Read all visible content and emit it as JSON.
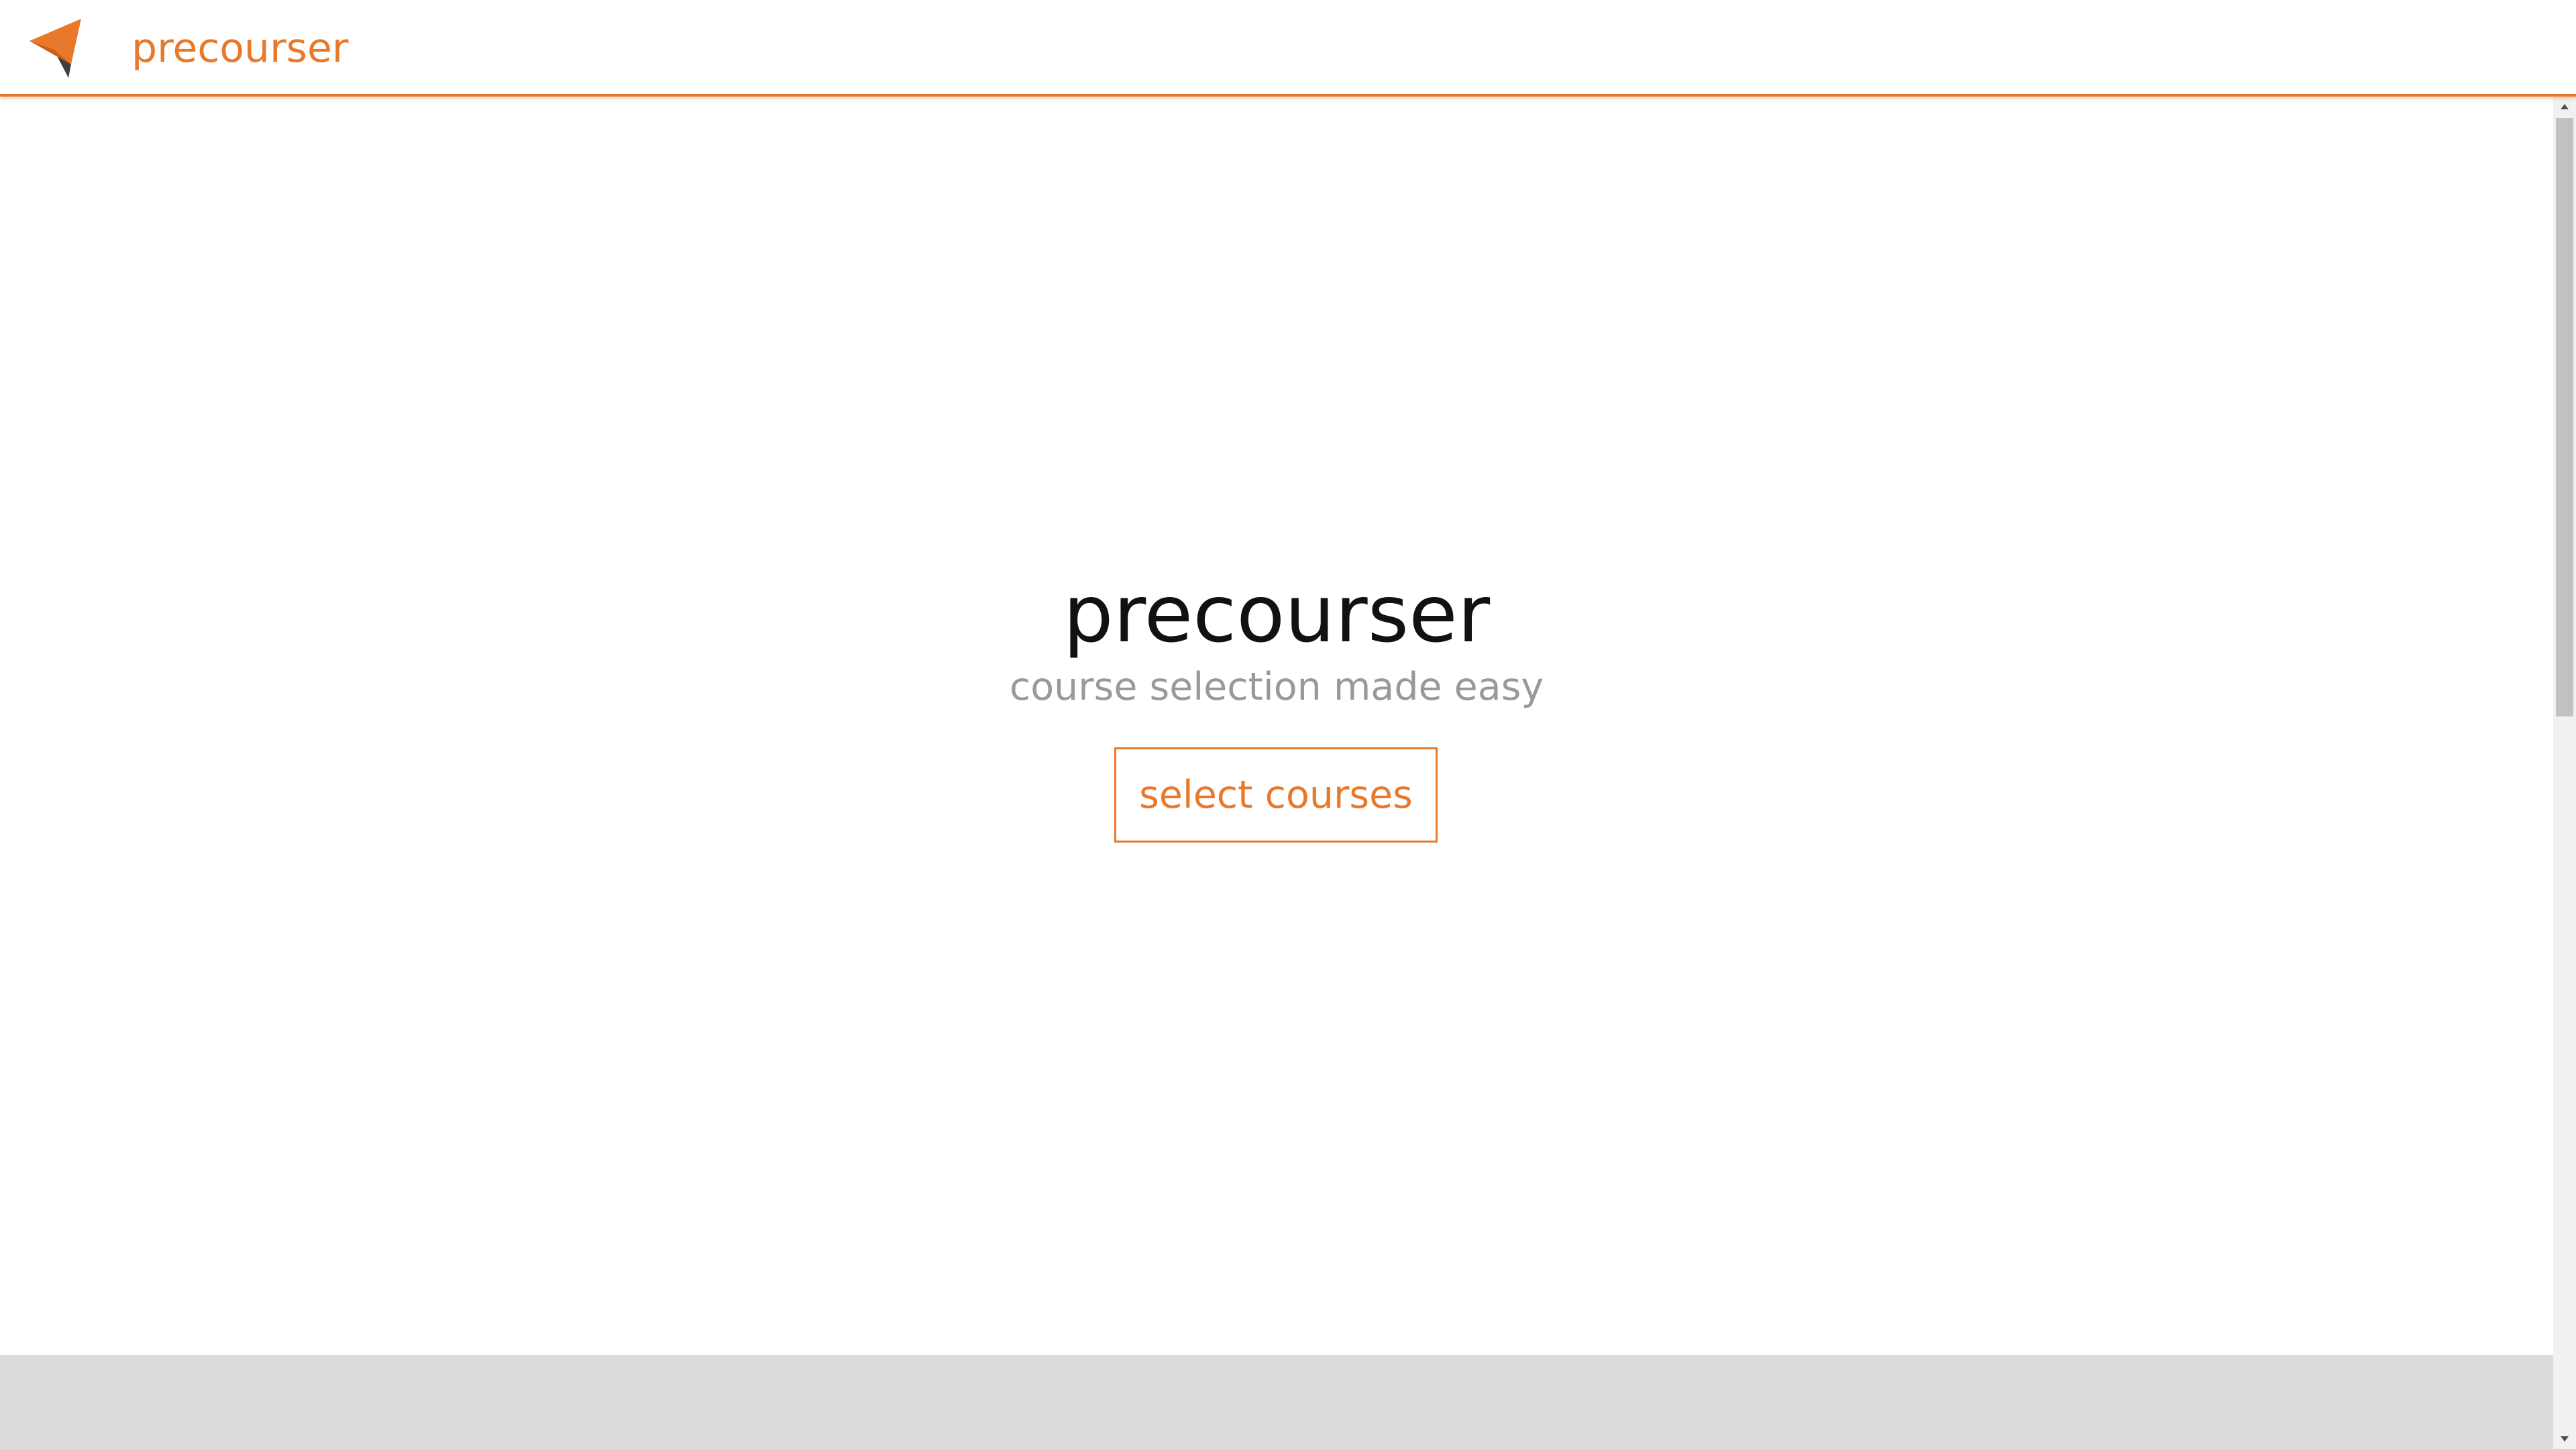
{
  "navbar": {
    "brand": "precourser",
    "logo_icon": "paper-plane-arrow-icon"
  },
  "hero": {
    "title": "precourser",
    "subtitle": "course selection made easy",
    "button_label": "select courses"
  },
  "colors": {
    "accent": "#e8792b",
    "logo_dark": "#3d3d3d",
    "subtitle": "#999999",
    "footer": "#dcdcdc"
  }
}
